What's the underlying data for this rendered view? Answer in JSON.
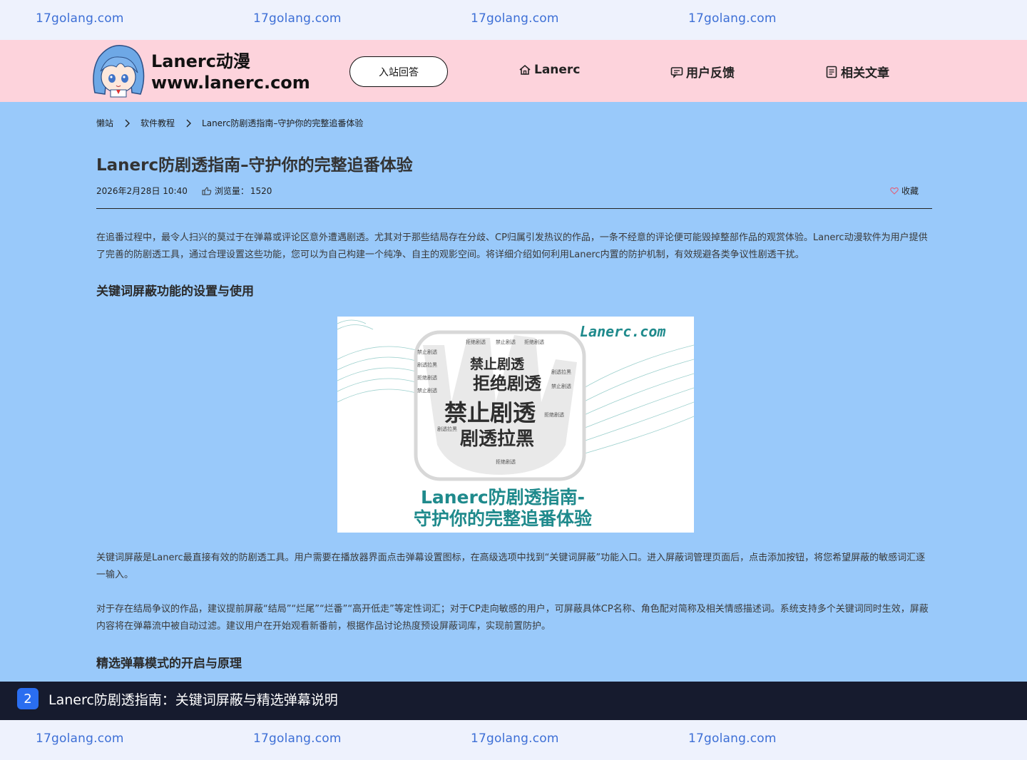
{
  "watermark": {
    "text": "17golang.com"
  },
  "header": {
    "logo_title": "Lanerc动漫",
    "logo_url": "www.lanerc.com",
    "cta_label": "入站回答",
    "nav": [
      "Lanerc",
      "用户反馈",
      "相关文章"
    ]
  },
  "breadcrumb": [
    "懒站",
    "软件教程",
    "Lanerc防剧透指南–守护你的完整追番体验"
  ],
  "article": {
    "title": "Lanerc防剧透指南–守护你的完整追番体验",
    "date": "2026年2月28日 10:40",
    "views_label": "浏览量：",
    "views": "1520",
    "favorite": "收藏",
    "intro": "在追番过程中，最令人扫兴的莫过于在弹幕或评论区意外遭遇剧透。尤其对于那些结局存在分歧、CP归属引发热议的作品，一条不经意的评论便可能毁掉整部作品的观赏体验。Lanerc动漫软件为用户提供了完善的防剧透工具，通过合理设置这些功能，您可以为自己构建一个纯净、自主的观影空间。将详细介绍如何利用Lanerc内置的防护机制，有效规避各类争议性剧透干扰。",
    "h2_1": "关键词屏蔽功能的设置与使用",
    "p1": "关键词屏蔽是Lanerc最直接有效的防剧透工具。用户需要在播放器界面点击弹幕设置图标，在高级选项中找到“关键词屏蔽”功能入口。进入屏蔽词管理页面后，点击添加按钮，将您希望屏蔽的敏感词汇逐一输入。",
    "p2": "对于存在结局争议的作品，建议提前屏蔽“结局”“烂尾”“烂番”“高开低走”等定性词汇；对于CP走向敏感的用户，可屏蔽具体CP名称、角色配对简称及相关情感描述词。系统支持多个关键词同时生效，屏蔽内容将在弹幕流中被自动过滤。建议用户在开始观看新番前，根据作品讨论热度预设屏蔽词库，实现前置防护。",
    "h2_2": "精选弹幕模式的开启与原理"
  },
  "figure": {
    "brand": "Lanerc.com",
    "big_words": [
      "禁止剧透",
      "拒绝剧透",
      "禁止剧透",
      "剧透拉黑"
    ],
    "small_words": [
      "禁止剧透",
      "剧透拉黑",
      "拒绝剧透"
    ],
    "caption_line1": "Lanerc防剧透指南-",
    "caption_line2": "守护你的完整追番体验",
    "accent": "#1f8a8c"
  },
  "bottom_caption": {
    "number": "2",
    "text": "Lanerc防剧透指南：关键词屏蔽与精选弹幕说明"
  },
  "colors": {
    "header_bg": "#fdd3dc",
    "page_bg": "#99c9fa",
    "watermark": "#3d6fd6",
    "caption_bg": "#161b2e"
  }
}
